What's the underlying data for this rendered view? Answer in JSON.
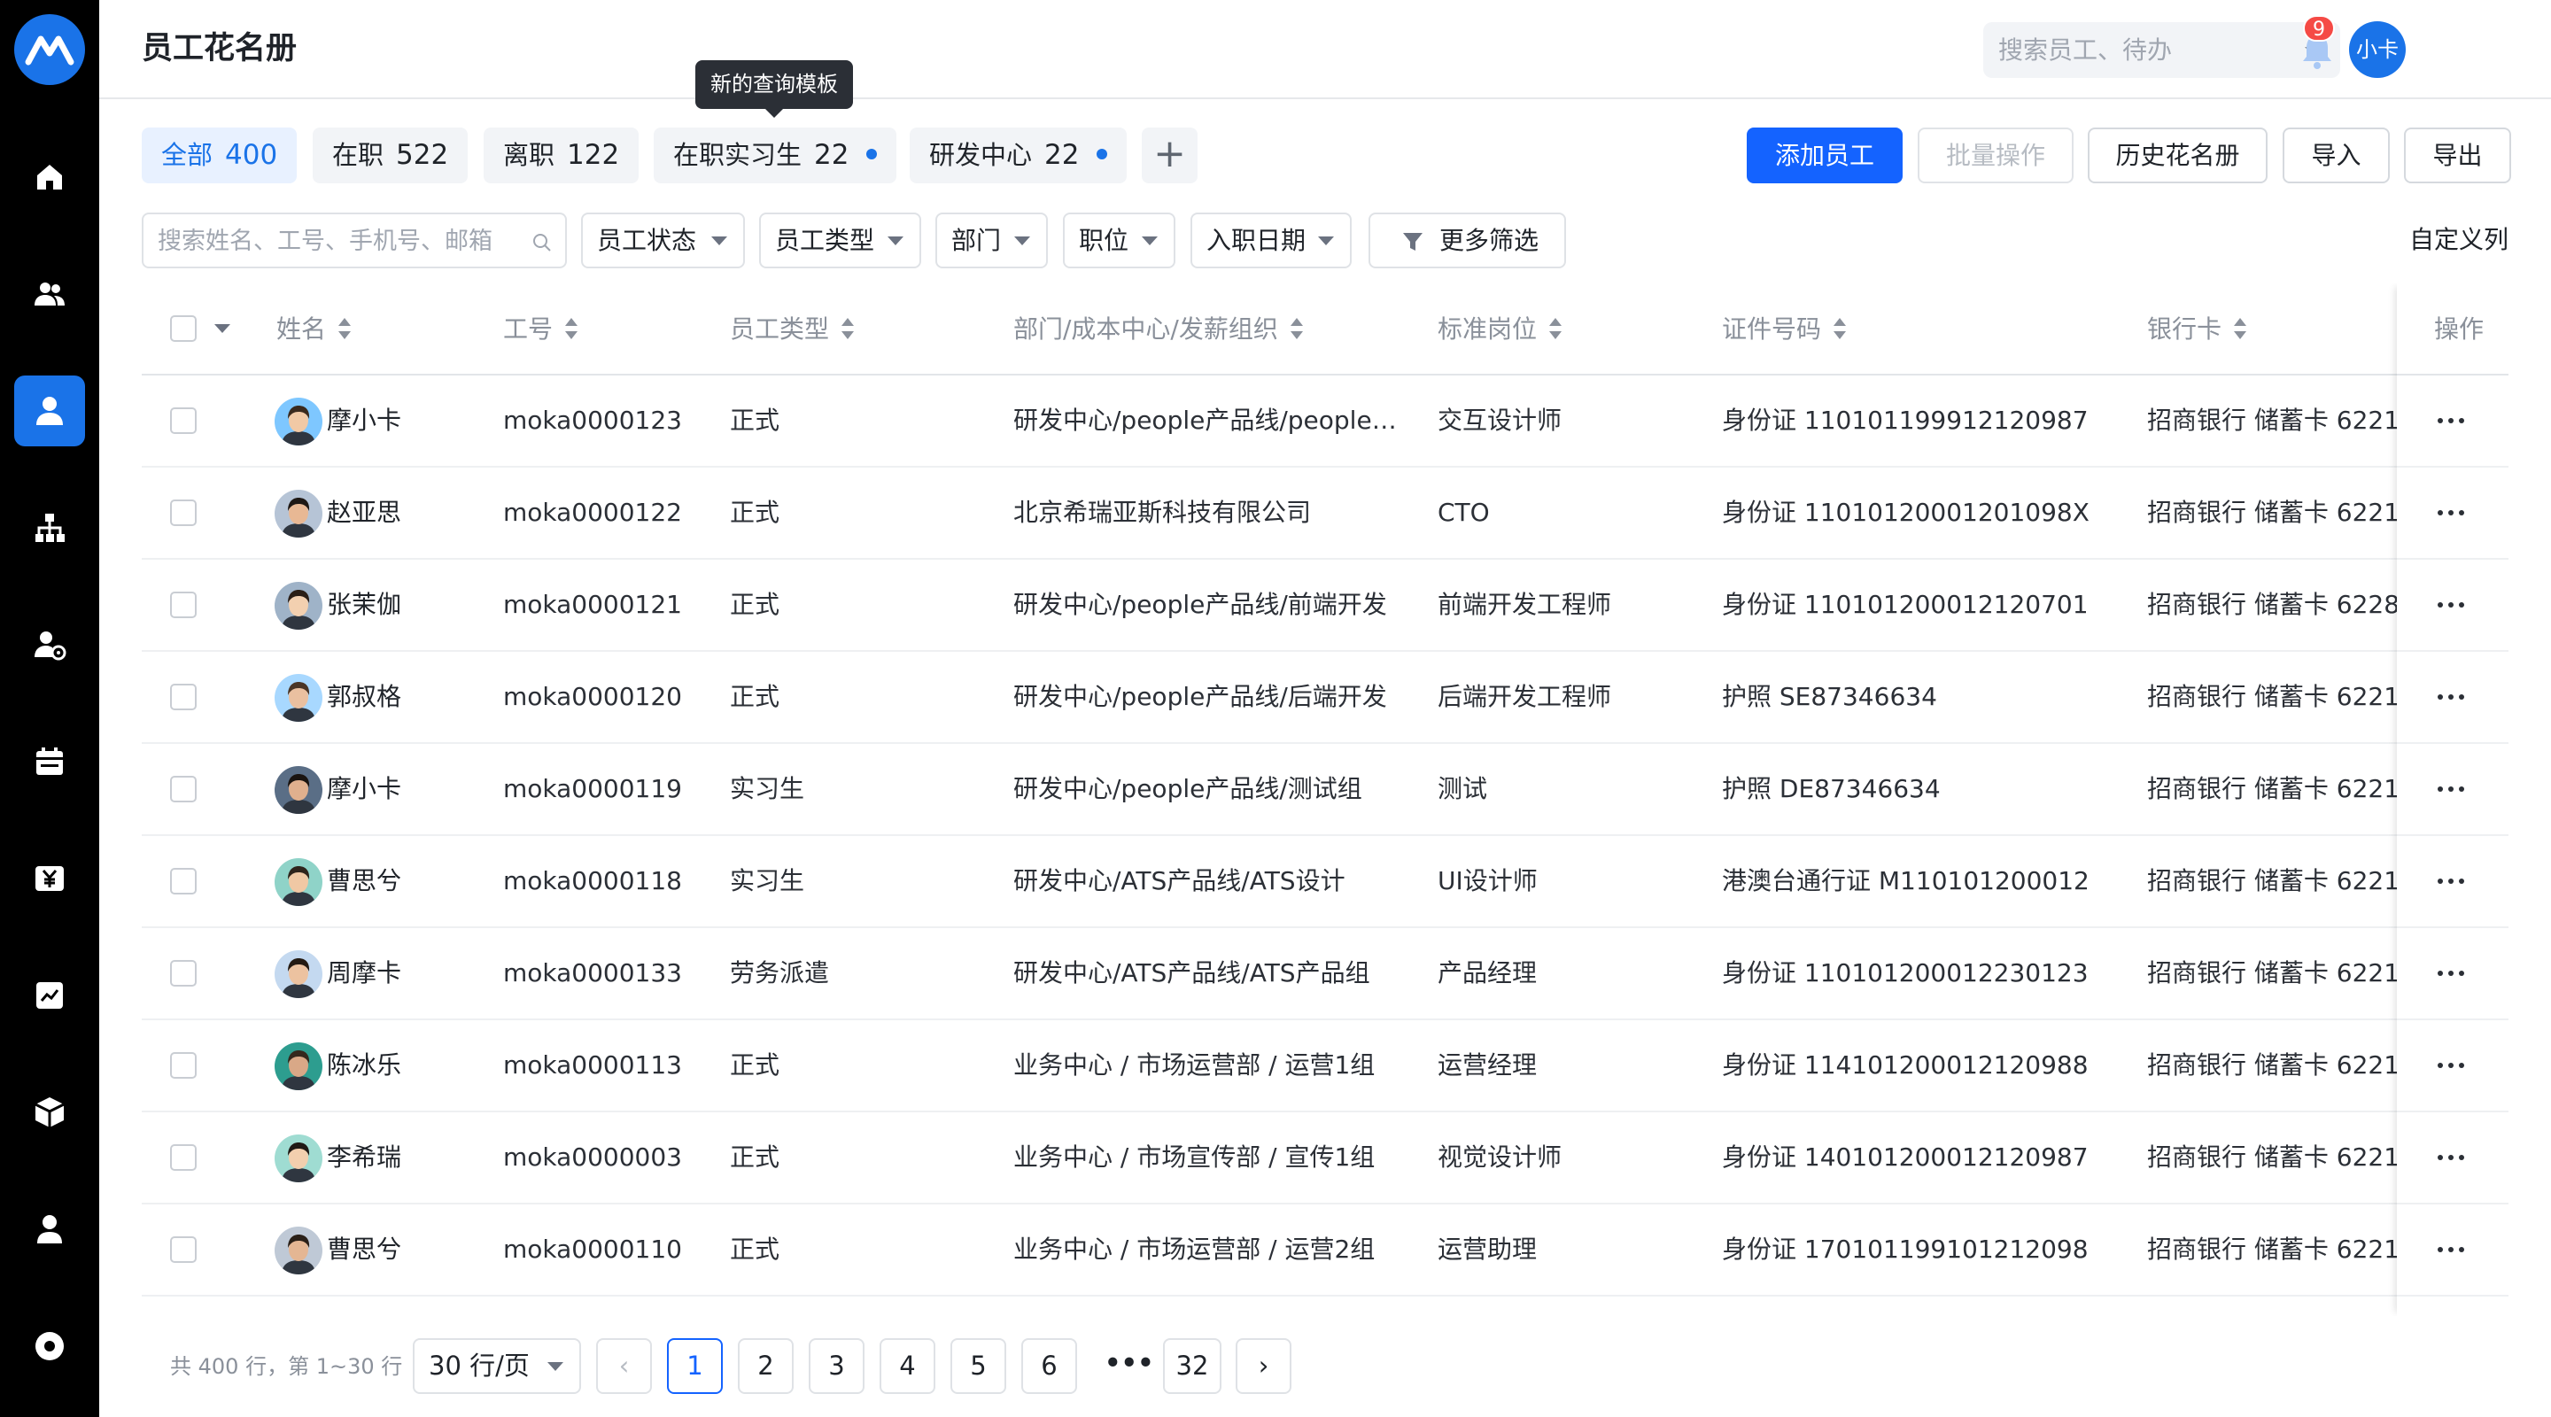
{
  "header": {
    "title": "员工花名册",
    "search_placeholder": "搜索员工、待办",
    "notification_count": "9",
    "user_initials": "小卡"
  },
  "nav": {
    "items": [
      "logo-icon",
      "home-icon",
      "team-icon",
      "person-icon",
      "org-chart-icon",
      "person-settings-icon",
      "calendar-icon",
      "yuan-icon",
      "report-icon",
      "package-icon",
      "profile-icon",
      "settings-icon"
    ],
    "active_index": 3,
    "accent": "#1a73e8"
  },
  "tabs": {
    "items": [
      {
        "label": "全部",
        "count": "400"
      },
      {
        "label": "在职",
        "count": "522"
      },
      {
        "label": "离职",
        "count": "122"
      },
      {
        "label": "在职实习生",
        "count": "22"
      },
      {
        "label": "研发中心",
        "count": "22"
      }
    ],
    "add": "+",
    "tooltip": "新的查询模板"
  },
  "actions": {
    "add_employee": "添加员工",
    "batch": "批量操作",
    "history": "历史花名册",
    "import": "导入",
    "export": "导出"
  },
  "filters": {
    "search_placeholder": "搜索姓名、工号、手机号、邮箱",
    "status": "员工状态",
    "type": "员工类型",
    "dept": "部门",
    "position": "职位",
    "join_date": "入职日期",
    "more": "更多筛选",
    "custom_columns": "自定义列"
  },
  "table": {
    "columns": [
      "姓名",
      "工号",
      "员工类型",
      "部门/成本中心/发薪组织",
      "标准岗位",
      "证件号码",
      "银行卡",
      "操作"
    ],
    "rows": [
      {
        "name": "摩小卡",
        "id": "moka0000123",
        "type": "正式",
        "dept": "研发中心/people产品线/people设计",
        "post": "交互设计师",
        "cert": "身份证 110101199912120987",
        "bank": "招商银行 储蓄卡 6221"
      },
      {
        "name": "赵亚思",
        "id": "moka0000122",
        "type": "正式",
        "dept": "北京希瑞亚斯科技有限公司",
        "post": "CTO",
        "cert": "身份证 11010120001201098X",
        "bank": "招商银行 储蓄卡 6221"
      },
      {
        "name": "张茉伽",
        "id": "moka0000121",
        "type": "正式",
        "dept": "研发中心/people产品线/前端开发",
        "post": "前端开发工程师",
        "cert": "身份证 110101200012120701",
        "bank": "招商银行 储蓄卡 6228"
      },
      {
        "name": "郭叔格",
        "id": "moka0000120",
        "type": "正式",
        "dept": "研发中心/people产品线/后端开发",
        "post": "后端开发工程师",
        "cert": "护照 SE87346634",
        "bank": "招商银行 储蓄卡 6221"
      },
      {
        "name": "摩小卡",
        "id": "moka0000119",
        "type": "实习生",
        "dept": "研发中心/people产品线/测试组",
        "post": "测试",
        "cert": "护照 DE87346634",
        "bank": "招商银行 储蓄卡 6221"
      },
      {
        "name": "曹思兮",
        "id": "moka0000118",
        "type": "实习生",
        "dept": "研发中心/ATS产品线/ATS设计",
        "post": "UI设计师",
        "cert": "港澳台通行证 M110101200012",
        "bank": "招商银行 储蓄卡 6221"
      },
      {
        "name": "周摩卡",
        "id": "moka0000133",
        "type": "劳务派遣",
        "dept": "研发中心/ATS产品线/ATS产品组",
        "post": "产品经理",
        "cert": "身份证 110101200012230123",
        "bank": "招商银行 储蓄卡 6221"
      },
      {
        "name": "陈冰乐",
        "id": "moka0000113",
        "type": "正式",
        "dept": "业务中心 / 市场运营部 / 运营1组",
        "post": "运营经理",
        "cert": "身份证 114101200012120988",
        "bank": "招商银行 储蓄卡 6221"
      },
      {
        "name": "李希瑞",
        "id": "moka0000003",
        "type": "正式",
        "dept": "业务中心 / 市场宣传部 / 宣传1组",
        "post": "视觉设计师",
        "cert": "身份证 140101200012120987",
        "bank": "招商银行 储蓄卡 6221"
      },
      {
        "name": "曹思兮",
        "id": "moka0000110",
        "type": "正式",
        "dept": "业务中心 / 市场运营部 / 运营2组",
        "post": "运营助理",
        "cert": "身份证 170101199101212098",
        "bank": "招商银行 储蓄卡 6221"
      }
    ]
  },
  "pagination": {
    "total": "共 400 行，第 1~30 行",
    "page_size": "30 行/页",
    "prev": "‹",
    "next": "›",
    "pages": [
      "1",
      "2",
      "3",
      "4",
      "5",
      "6"
    ],
    "ellipsis": "•••",
    "last": "32",
    "current": "1"
  },
  "colors": {
    "primary": "#1463ff",
    "tab_active_bg": "#e8f1ff",
    "badge": "#f54a45"
  }
}
